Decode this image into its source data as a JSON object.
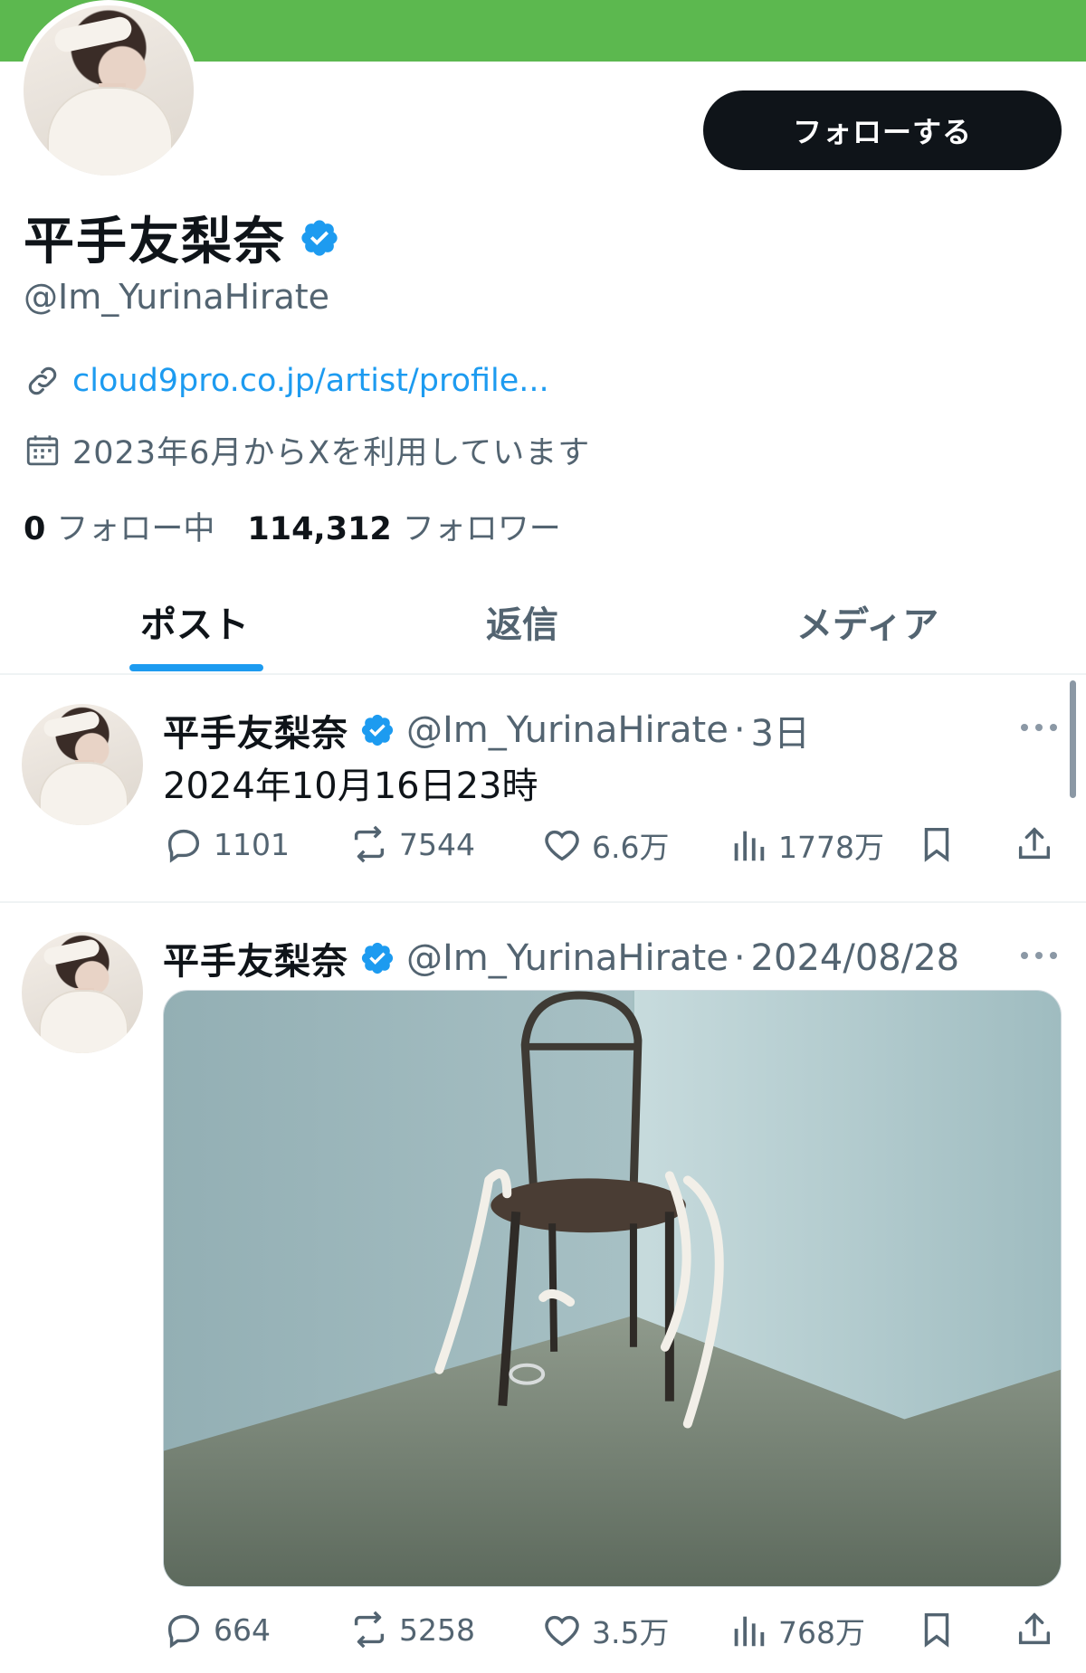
{
  "profile": {
    "name": "平手友梨奈",
    "handle": "@Im_YurinaHirate",
    "follow_label": "フォローする",
    "link": "cloud9pro.co.jp/artist/profile...",
    "joined": "2023年6月からXを利用しています",
    "following_count": "0",
    "following_label": "フォロー中",
    "followers_count": "114,312",
    "followers_label": "フォロワー",
    "banner_color": "#5cb84f",
    "verified_color": "#1d9bf0"
  },
  "tabs": [
    {
      "label": "ポスト",
      "active": true
    },
    {
      "label": "返信",
      "active": false
    },
    {
      "label": "メディア",
      "active": false
    }
  ],
  "posts": [
    {
      "name": "平手友梨奈",
      "handle": "@Im_YurinaHirate",
      "time": "3日",
      "text": "2024年10月16日23時",
      "replies": "1101",
      "reposts": "7544",
      "likes": "6.6万",
      "views": "1778万"
    },
    {
      "name": "平手友梨奈",
      "handle": "@Im_YurinaHirate",
      "time": "2024/08/28",
      "media": "chair-in-corner-photo",
      "replies": "664",
      "reposts": "5258",
      "likes": "3.5万",
      "views": "768万"
    }
  ],
  "icons": {
    "link": "link-icon",
    "calendar": "calendar-icon",
    "reply": "reply-icon",
    "repost": "repost-icon",
    "like": "heart-icon",
    "views": "views-icon",
    "bookmark": "bookmark-icon",
    "share": "share-icon"
  }
}
